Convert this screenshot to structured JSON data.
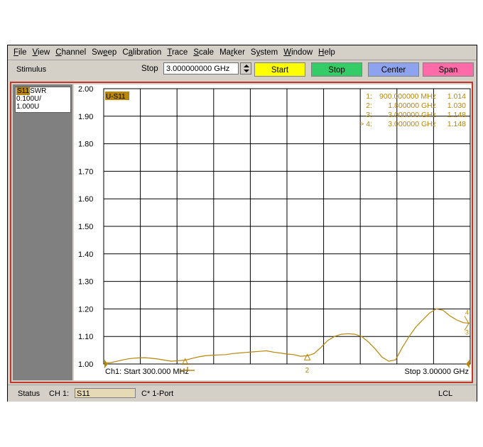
{
  "menu": [
    "File",
    "View",
    "Channel",
    "Sweep",
    "Calibration",
    "Trace",
    "Scale",
    "Marker",
    "System",
    "Window",
    "Help"
  ],
  "toolbar": {
    "stimulus_label": "Stimulus",
    "stop_label": "Stop",
    "stop_value": "3.000000000 GHz",
    "buttons": [
      {
        "label": "Start",
        "color": "#ffff00"
      },
      {
        "label": "Stop",
        "color": "#33cc66"
      },
      {
        "label": "Center",
        "color": "#8ea3f0"
      },
      {
        "label": "Span",
        "color": "#ff6aa8"
      }
    ]
  },
  "trace_info": {
    "badge": "S11",
    "format": "SWR",
    "scale": "0.100U/",
    "ref": "1.000U"
  },
  "trace_label": "U-S11",
  "markers": [
    {
      "id": "1:",
      "freq": "900.000000 MHz",
      "value": "1.014"
    },
    {
      "id": "2:",
      "freq": "1.800000 GHz",
      "value": "1.030"
    },
    {
      "id": "3:",
      "freq": "3.000000 GHz",
      "value": "1.148"
    },
    {
      "id": "> 4:",
      "freq": "3.000000 GHz",
      "value": "1.148"
    }
  ],
  "footer": {
    "start": "Ch1: Start  300.000 MHz",
    "stop": "Stop  3.00000 GHz"
  },
  "status": {
    "status_label": "Status",
    "channel": "CH 1:",
    "param": "S11",
    "port": "C* 1-Port",
    "lcl": "LCL"
  },
  "colors": {
    "trace": "#b8860b",
    "grid": "#000000",
    "frame": "#c0392b"
  },
  "chart_data": {
    "type": "line",
    "ylim": [
      1.0,
      2.0
    ],
    "yticks": [
      "2.00",
      "1.90",
      "1.80",
      "1.70",
      "1.60",
      "1.50",
      "1.40",
      "1.30",
      "1.20",
      "1.10",
      "1.00"
    ],
    "xlim_ghz": [
      0.3,
      3.0
    ],
    "grid": true,
    "series": [
      {
        "name": "S11",
        "x": [
          0.3,
          0.35,
          0.4,
          0.45,
          0.5,
          0.55,
          0.6,
          0.65,
          0.7,
          0.75,
          0.8,
          0.85,
          0.9,
          0.95,
          1.0,
          1.05,
          1.1,
          1.15,
          1.2,
          1.25,
          1.3,
          1.35,
          1.4,
          1.45,
          1.5,
          1.55,
          1.6,
          1.65,
          1.7,
          1.75,
          1.8,
          1.85,
          1.9,
          1.95,
          2.0,
          2.05,
          2.1,
          2.15,
          2.2,
          2.25,
          2.3,
          2.35,
          2.4,
          2.45,
          2.5,
          2.55,
          2.6,
          2.65,
          2.7,
          2.75,
          2.8,
          2.85,
          2.9,
          2.95,
          3.0
        ],
        "y": [
          1.003,
          1.005,
          1.01,
          1.016,
          1.02,
          1.022,
          1.023,
          1.021,
          1.018,
          1.014,
          1.01,
          1.012,
          1.014,
          1.02,
          1.026,
          1.03,
          1.032,
          1.033,
          1.034,
          1.038,
          1.04,
          1.042,
          1.044,
          1.046,
          1.048,
          1.043,
          1.04,
          1.036,
          1.034,
          1.028,
          1.03,
          1.038,
          1.06,
          1.085,
          1.1,
          1.108,
          1.11,
          1.108,
          1.1,
          1.08,
          1.055,
          1.025,
          1.01,
          1.015,
          1.06,
          1.1,
          1.135,
          1.16,
          1.185,
          1.2,
          1.195,
          1.175,
          1.16,
          1.15,
          1.148
        ]
      }
    ]
  }
}
